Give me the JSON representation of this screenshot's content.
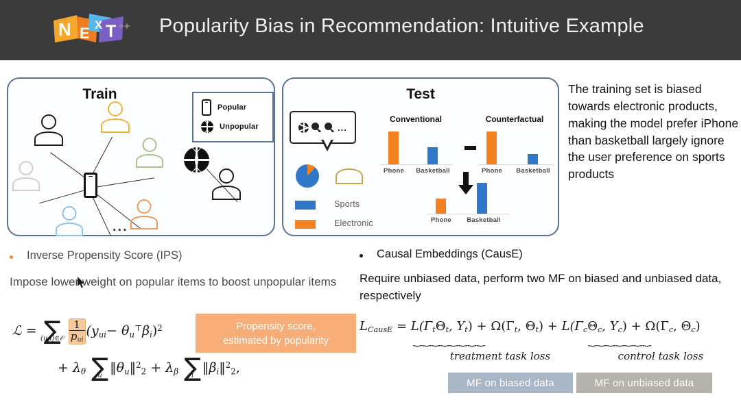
{
  "header": {
    "logo_letters": [
      "N",
      "E",
      "X",
      "T"
    ],
    "logo_suffix": "++",
    "title": "Popularity Bias in Recommendation: Intuitive Example",
    "bg_color": "#3b3b3b"
  },
  "train_panel": {
    "title": "Train",
    "legend": [
      {
        "icon": "phone-icon",
        "label": "Popular"
      },
      {
        "icon": "basketball-icon",
        "label": "Unpopular"
      }
    ],
    "ellipsis": "...",
    "people_colors": [
      "#1d1d1d",
      "#f0b33c",
      "#a8c48a",
      "#cfcfcf",
      "#8fc0e8",
      "#ef9a5c",
      "#1d1d1d"
    ]
  },
  "test_panel": {
    "title": "Test",
    "bubble_icons": [
      "volleyball-icon",
      "pingpong-paddle-icon",
      "pingpong-paddle-icon"
    ],
    "bubble_ellipsis": "...",
    "legend": [
      {
        "label": "Sports",
        "color": "#2f77c9"
      },
      {
        "label": "Electronic",
        "color": "#f58220"
      }
    ],
    "minus_symbol": "−",
    "charts": [
      {
        "title": "Conventional",
        "categories": [
          "Phone",
          "Basketball"
        ],
        "values": [
          100,
          52
        ],
        "colors": [
          "#f58220",
          "#2f77c9"
        ]
      },
      {
        "title": "Counterfactual",
        "categories": [
          "Phone",
          "Basketball"
        ],
        "values": [
          100,
          30
        ],
        "colors": [
          "#f58220",
          "#2f77c9"
        ]
      },
      {
        "title": "",
        "categories": [
          "Phone",
          "Basketball"
        ],
        "values": [
          45,
          88
        ],
        "colors": [
          "#f58220",
          "#2f77c9"
        ]
      }
    ],
    "pie": {
      "segments": [
        {
          "color": "#2f77c9",
          "pct": 88
        },
        {
          "color": "#f58220",
          "pct": 12
        }
      ]
    }
  },
  "description": "The training set is biased towards electronic products, making the model prefer iPhone than basketball largely ignore the user preference on sports products",
  "left_section": {
    "bullet_color": "#e8893f",
    "bullet_title": "Inverse Propensity Score (IPS)",
    "body": "Impose lower weight on popular items to boost unpopular items",
    "callout_line1": "Propensity score,",
    "callout_line2": "estimated by popularity",
    "callout_color": "#f6ad77",
    "formula": {
      "lhs": "ℒ",
      "equals": "=",
      "sum_sub": "(u,i)∈𝒪",
      "frac_num": "1",
      "frac_den": "p",
      "frac_den_sub": "ui",
      "term1": "(y",
      "term1_sub": "ui",
      "term2": "− θ",
      "term2_sub": "u",
      "term2_sup": "⊤",
      "term3": "β",
      "term3_sub": "i",
      "term4": ")",
      "term4_sup": "2",
      "line2_a": "+ λ",
      "line2_a_sub": "θ",
      "line2_b": "‖θ",
      "line2_b_sub": "u",
      "line2_b_norm": "‖",
      "line2_b_sup": "2",
      "line2_b_sub2": "2",
      "line2_c": "+ λ",
      "line2_c_sub": "β",
      "line2_d": "‖β",
      "line2_d_sub": "i",
      "line2_d_norm": "‖",
      "sum_u": "u",
      "sum_i": "i",
      "end": ","
    }
  },
  "right_section": {
    "bullet_color": "#1a1a1a",
    "bullet_title": "Causal Embeddings (CausE)",
    "body": "Require unbiased data, perform two MF on biased and unbiased data, respectively",
    "formula": {
      "lhs": "L",
      "lhs_sub": "CausE",
      "equals": "=",
      "t1": "L(Γ",
      "t1_s1": "t",
      "t1_b": "Θ",
      "t1_s2": "t",
      "t1_c": ", Y",
      "t1_s3": "t",
      "t1_d": ")",
      "t2": "+ Ω(Γ",
      "t2_s1": "t",
      "t2_b": ", Θ",
      "t2_s2": "t",
      "t2_c": ")",
      "t3": "+ L(Γ",
      "t3_s1": "c",
      "t3_b": "Θ",
      "t3_s2": "c",
      "t3_c": ", Y",
      "t3_s3": "c",
      "t3_d": ")",
      "t4": "+ Ω(Γ",
      "t4_s1": "c",
      "t4_b": ", Θ",
      "t4_s2": "c",
      "t4_c": ")"
    },
    "brace_label_1": "treatment task loss",
    "brace_label_2": "control task loss",
    "tag_1": {
      "label": "MF on biased data",
      "color": "#a9b6c6"
    },
    "tag_2": {
      "label": "MF on unbiased data",
      "color": "#b6b3ad"
    }
  }
}
